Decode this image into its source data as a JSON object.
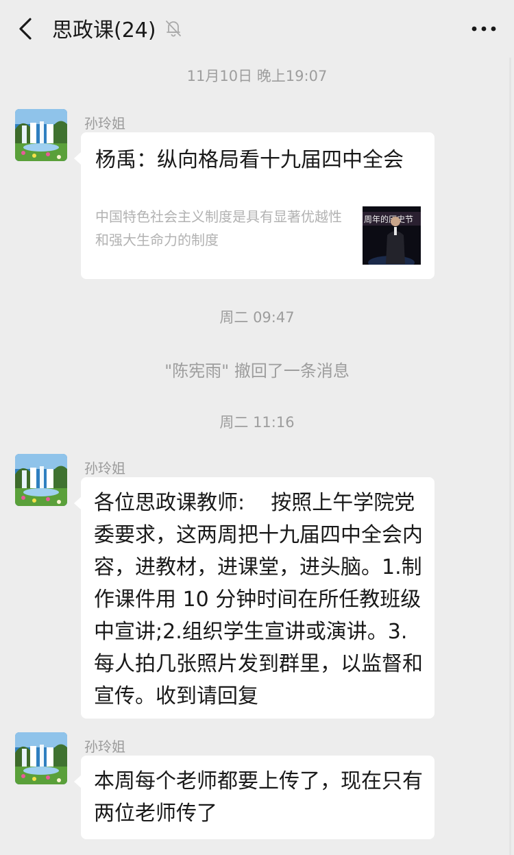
{
  "header": {
    "title": "思政课(24)"
  },
  "messages_area": {
    "time_1": "11月10日 晚上19:07",
    "time_2": "周二 09:47",
    "system_notice": "\"陈宪雨\" 撤回了一条消息",
    "time_3": "周二 11:16",
    "msg1": {
      "sender": "孙玲姐",
      "link_title": "杨禹：纵向格局看十九届四中全会",
      "link_desc": "中国特色社会主义制度是具有显著优越性和强大生命力的制度"
    },
    "msg2": {
      "sender": "孙玲姐",
      "text": "各位思政课教师:    按照上午学院党委要求，这两周把十九届四中全会内容，进教材，进课堂，进头脑。1.制作课件用 10 分钟时间在所任教班级中宣讲;2.组织学生宣讲或演讲。3.每人拍几张照片发到群里，以监督和宣传。收到请回复"
    },
    "msg3": {
      "sender": "孙玲姐",
      "text": "本周每个老师都要上传了，现在只有两位老师传了"
    }
  },
  "icons": {
    "back": "chevron-left-icon",
    "mute": "bell-off-icon",
    "more": "ellipsis-icon",
    "avatar": "waterfall-avatar"
  },
  "colors": {
    "background": "#ededed",
    "bubble": "#ffffff",
    "muted_text": "#9d9d9d"
  }
}
